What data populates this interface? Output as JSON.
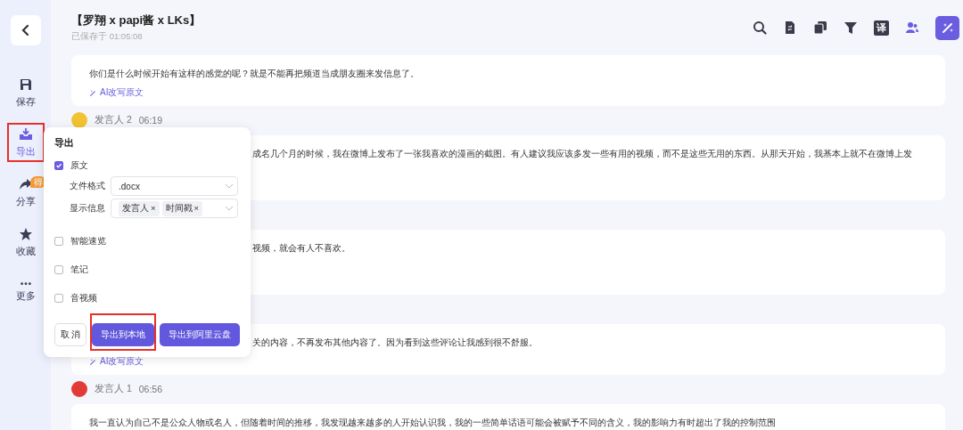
{
  "sidebar": {
    "items": [
      {
        "label": "保存",
        "selected": false,
        "highlighted": false
      },
      {
        "label": "导出",
        "selected": true,
        "highlighted": true
      },
      {
        "label": "分享",
        "selected": false,
        "highlighted": false,
        "badge": "得"
      },
      {
        "label": "收藏",
        "selected": false,
        "highlighted": false
      },
      {
        "label": "更多",
        "selected": false,
        "highlighted": false
      }
    ]
  },
  "header": {
    "title": "【罗翔 x papi酱 x LKs】",
    "saved": "已保存于 01:05:08",
    "tools": [
      {
        "kind": "icon",
        "active": false
      },
      {
        "kind": "icon",
        "active": false
      },
      {
        "kind": "icon",
        "active": false
      },
      {
        "kind": "icon",
        "active": false
      },
      {
        "kind": "text",
        "text": "译",
        "active": false
      },
      {
        "kind": "icon",
        "active": true
      },
      {
        "kind": "filled",
        "active": true
      }
    ]
  },
  "paragraphs": [
    {
      "text": "你们是什么时候开始有这样的感觉的呢？就是不能再把频道当成朋友圈来发信息了。",
      "link": "AI改写原文",
      "under_dialog": false
    },
    {
      "speaker": "发言人 2",
      "time": "06:19",
      "color": "#f2c230",
      "text": "成名几个月的时候，我在微博上发布了一张我喜欢的漫画的截图。有人建议我应该多发一些有用的视频，而不是这些无用的东西。从那天开始，我基本上就不在微博上发",
      "under_dialog": true
    },
    {
      "text": "视频，就会有人不喜欢。",
      "under_dialog": true
    },
    {
      "text": "关的内容，不再发布其他内容了。因为看到这些评论让我感到很不舒服。",
      "link": "AI改写原文",
      "under_dialog": true
    },
    {
      "speaker": "发言人 1",
      "time": "06:56",
      "color": "#e23b35",
      "text": "我一直认为自己不是公众人物或名人，但随着时间的推移，我发现越来越多的人开始认识我，我的一些简单话语可能会被赋予不同的含义，我的影响力有时超出了我的控制范围",
      "under_dialog": false
    }
  ],
  "export_dialog": {
    "title": "导出",
    "options": [
      {
        "label": "原文",
        "checked": true,
        "fields": [
          {
            "label": "文件格式",
            "value": ".docx"
          },
          {
            "label": "显示信息",
            "tags": [
              {
                "label": "发言人",
                "remove": "×"
              },
              {
                "label": "时间戳",
                "remove": "×"
              }
            ]
          }
        ]
      },
      {
        "label": "智能速览",
        "checked": false
      },
      {
        "label": "笔记",
        "checked": false
      },
      {
        "label": "音视频",
        "checked": false
      }
    ],
    "buttons": [
      {
        "label": "取 消",
        "kind": "secondary",
        "highlighted": false
      },
      {
        "label": "导出到本地",
        "kind": "primary",
        "highlighted": true
      },
      {
        "label": "导出到阿里云盘",
        "kind": "primary",
        "highlighted": false
      }
    ]
  }
}
